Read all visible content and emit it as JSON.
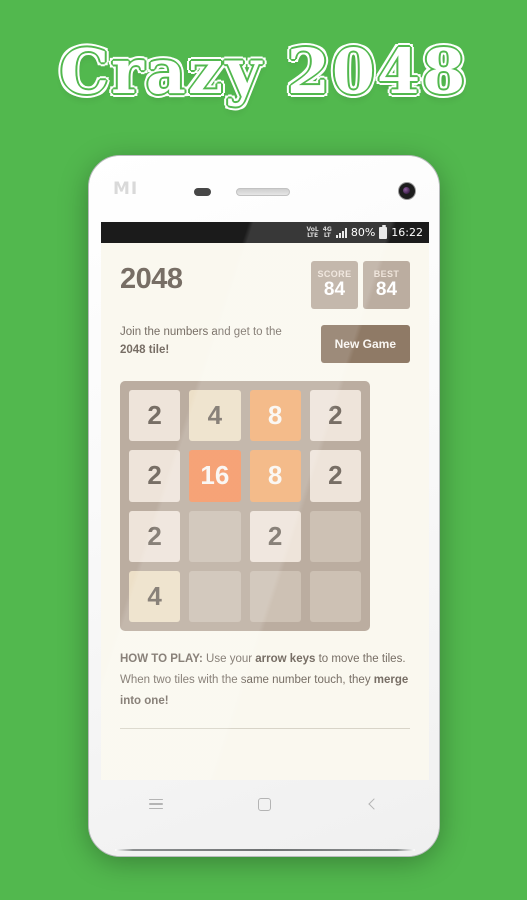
{
  "banner": {
    "title": "Crazy 2048"
  },
  "background_color": "#52b84e",
  "phone": {
    "brand_logo": "MI",
    "hardware": {
      "sensor": "proximity-sensor",
      "earpiece": "earpiece-speaker",
      "camera": "front-camera"
    }
  },
  "statusbar": {
    "volte_line1": "VoL",
    "volte_line2": "LTE",
    "network_line1": "4G",
    "network_line2": "LT",
    "battery_percent": "80%",
    "clock": "16:22"
  },
  "game": {
    "title": "2048",
    "score": {
      "label": "SCORE",
      "value": "84"
    },
    "best": {
      "label": "BEST",
      "value": "84"
    },
    "intro_prefix": "Join the numbers and get to the ",
    "intro_bold": "2048 tile!",
    "new_game_label": "New Game",
    "board": [
      [
        "2",
        "4",
        "8",
        "2"
      ],
      [
        "2",
        "16",
        "8",
        "2"
      ],
      [
        "2",
        "",
        "2",
        ""
      ],
      [
        "4",
        "",
        "",
        ""
      ]
    ],
    "howto": {
      "heading": "HOW TO PLAY:",
      "part1": " Use your ",
      "bold1": "arrow keys",
      "part2": " to move the tiles. When two tiles with the same number touch, they ",
      "bold2": "merge into one!"
    },
    "colors": {
      "page_bg": "#faf8ef",
      "grid_bg": "#bbada0",
      "empty_cell": "#cdc1b4",
      "tile_2": "#eee4da",
      "tile_4": "#ede0c8",
      "tile_8": "#f2b179",
      "tile_16": "#f59563",
      "text_dark": "#776e65",
      "button": "#8f7a66"
    }
  },
  "navbar": {
    "menu": "menu-icon",
    "home": "home-icon",
    "back": "back-icon"
  }
}
